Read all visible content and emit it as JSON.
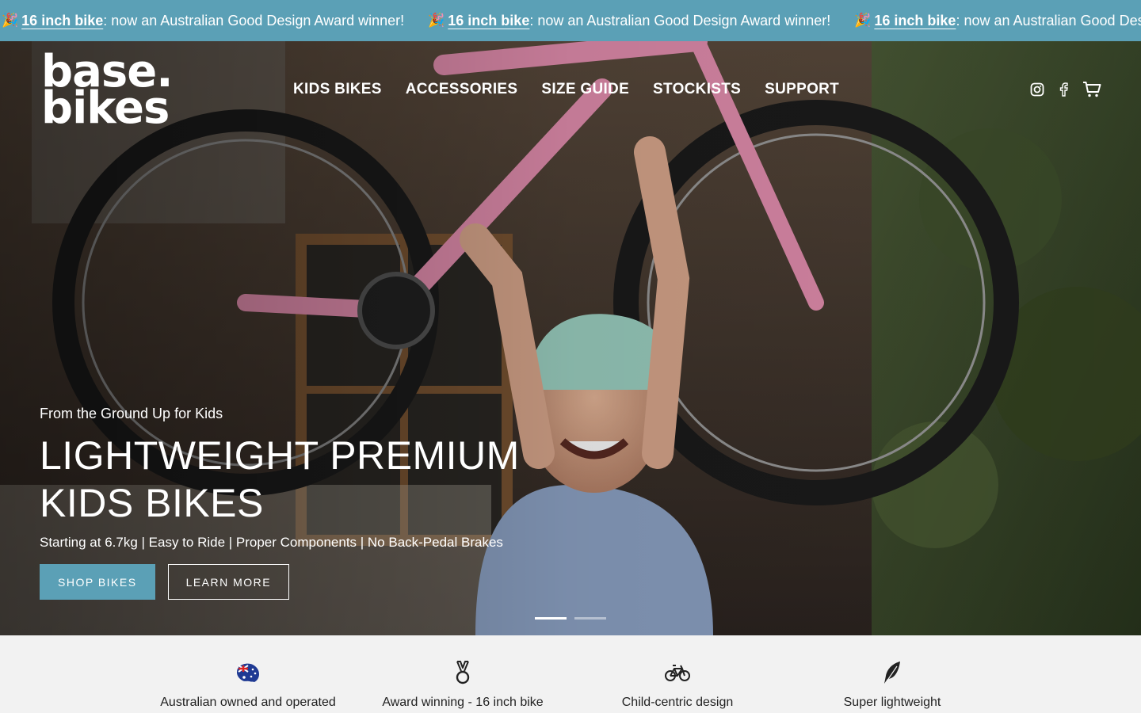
{
  "announcement": {
    "emoji": "🎉",
    "link_text": "16 inch bike",
    "message": ": now an Australian Good Design Award winner!"
  },
  "header": {
    "logo_line1": "base.",
    "logo_line2": "bikes",
    "nav": [
      "KIDS BIKES",
      "ACCESSORIES",
      "SIZE GUIDE",
      "STOCKISTS",
      "SUPPORT"
    ],
    "icons": [
      "instagram-icon",
      "facebook-icon",
      "cart-icon"
    ]
  },
  "hero": {
    "eyebrow": "From the Ground Up for Kids",
    "headline_line1": "LIGHTWEIGHT PREMIUM",
    "headline_line2": "KIDS BIKES",
    "subline": "Starting at 6.7kg | Easy to Ride | Proper Components | No Back-Pedal Brakes",
    "primary_cta": "SHOP BIKES",
    "secondary_cta": "LEARN MORE",
    "slides": 2,
    "active_slide": 1
  },
  "features": [
    {
      "label": "Australian owned and operated",
      "icon": "australia-flag-icon"
    },
    {
      "label": "Award winning - 16 inch bike",
      "icon": "medal-icon"
    },
    {
      "label": "Child-centric design",
      "icon": "bicycle-icon"
    },
    {
      "label": "Super lightweight",
      "icon": "feather-icon"
    }
  ],
  "colors": {
    "accent": "#5ba0b6",
    "background": "#f2f2f2"
  }
}
